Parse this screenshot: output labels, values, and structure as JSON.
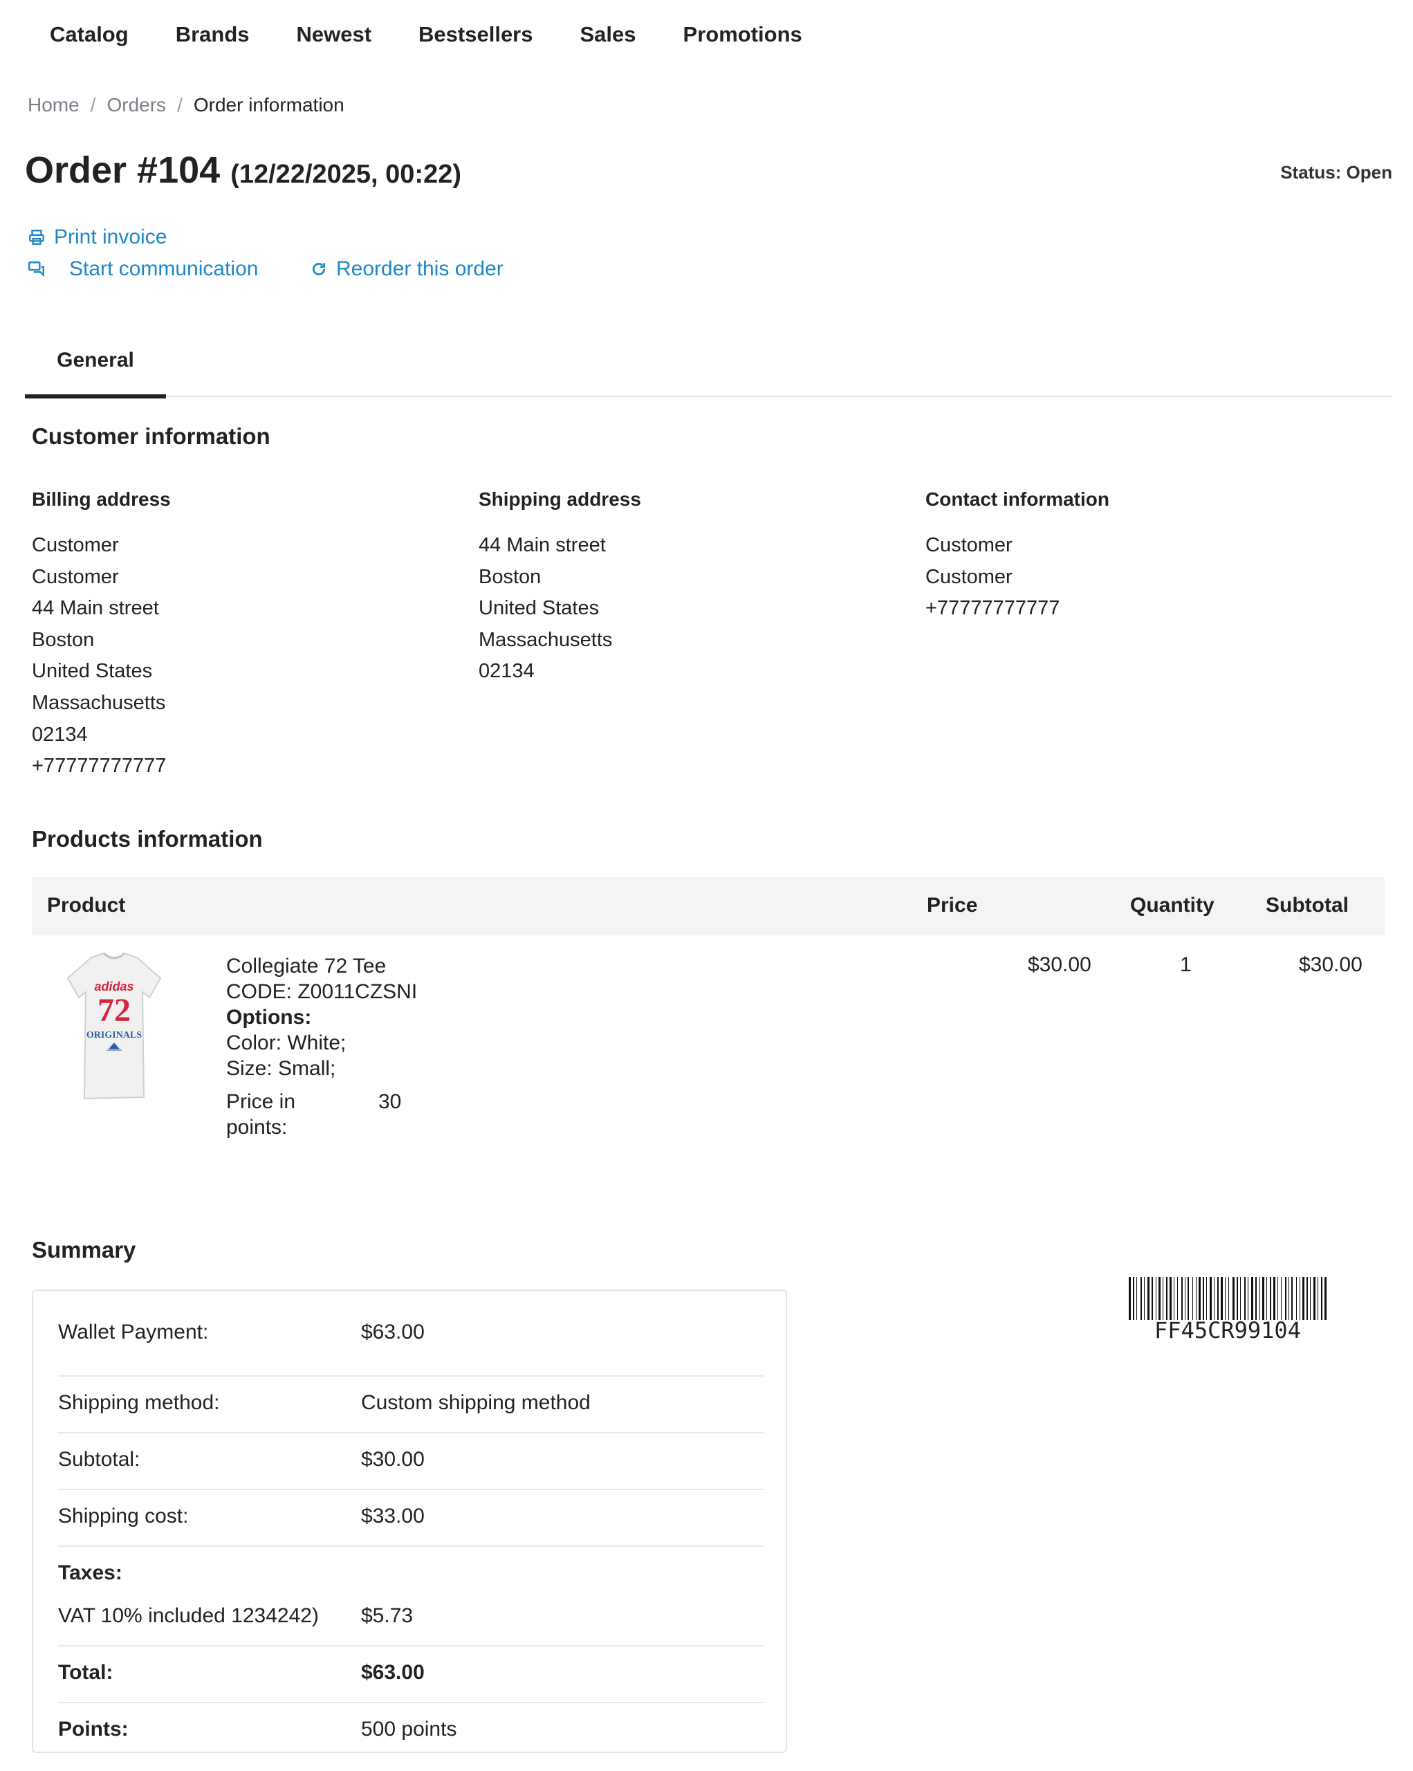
{
  "nav": [
    "Catalog",
    "Brands",
    "Newest",
    "Bestsellers",
    "Sales",
    "Promotions"
  ],
  "breadcrumb": {
    "home": "Home",
    "orders": "Orders",
    "current": "Order information",
    "sep": "/"
  },
  "order": {
    "title": "Order #104",
    "date": "(12/22/2025, 00:22)",
    "status": "Status: Open"
  },
  "actions": {
    "print": "Print invoice",
    "communicate": "Start communication",
    "reorder": "Reorder this order"
  },
  "tabs": {
    "general": "General"
  },
  "customer": {
    "title": "Customer information",
    "billing": {
      "title": "Billing address",
      "lines": [
        "Customer",
        "Customer",
        "44 Main street",
        "Boston",
        "United States",
        "Massachusetts",
        "02134",
        "+77777777777"
      ]
    },
    "shipping": {
      "title": "Shipping address",
      "lines": [
        "44 Main street",
        "Boston",
        "United States",
        "Massachusetts",
        "02134"
      ]
    },
    "contact": {
      "title": "Contact information",
      "lines": [
        "Customer",
        "Customer",
        "+77777777777"
      ]
    }
  },
  "products": {
    "title": "Products information",
    "headers": {
      "product": "Product",
      "price": "Price",
      "quantity": "Quantity",
      "subtotal": "Subtotal"
    },
    "items": [
      {
        "name": "Collegiate 72 Tee",
        "code": "CODE: Z0011CZSNI",
        "options_label": "Options:",
        "color": "Color: White;",
        "size": "Size: Small;",
        "points_label": "Price in points:",
        "points_value": "30",
        "price": "$30.00",
        "quantity": "1",
        "subtotal": "$30.00",
        "image_text": {
          "brand": "adidas",
          "number": "72",
          "sub": "ORIGINALS"
        }
      }
    ]
  },
  "summary": {
    "title": "Summary",
    "wallet_label": "Wallet Payment:",
    "wallet_value": "$63.00",
    "shipping_method_label": "Shipping method:",
    "shipping_method_value": "Custom shipping method",
    "subtotal_label": "Subtotal:",
    "subtotal_value": "$30.00",
    "shipping_cost_label": "Shipping cost:",
    "shipping_cost_value": "$33.00",
    "taxes_label": "Taxes:",
    "vat_label": "VAT 10% included 1234242)",
    "vat_value": "$5.73",
    "total_label": "Total:",
    "total_value": "$63.00",
    "points_label": "Points:",
    "points_value": "500 points"
  },
  "barcode": "FF45CR99104",
  "colors": {
    "link": "#1e88c7",
    "text": "#222222",
    "muted": "#7a7f86",
    "tshirt_red": "#d8233a",
    "tshirt_blue": "#2b5aa6"
  }
}
